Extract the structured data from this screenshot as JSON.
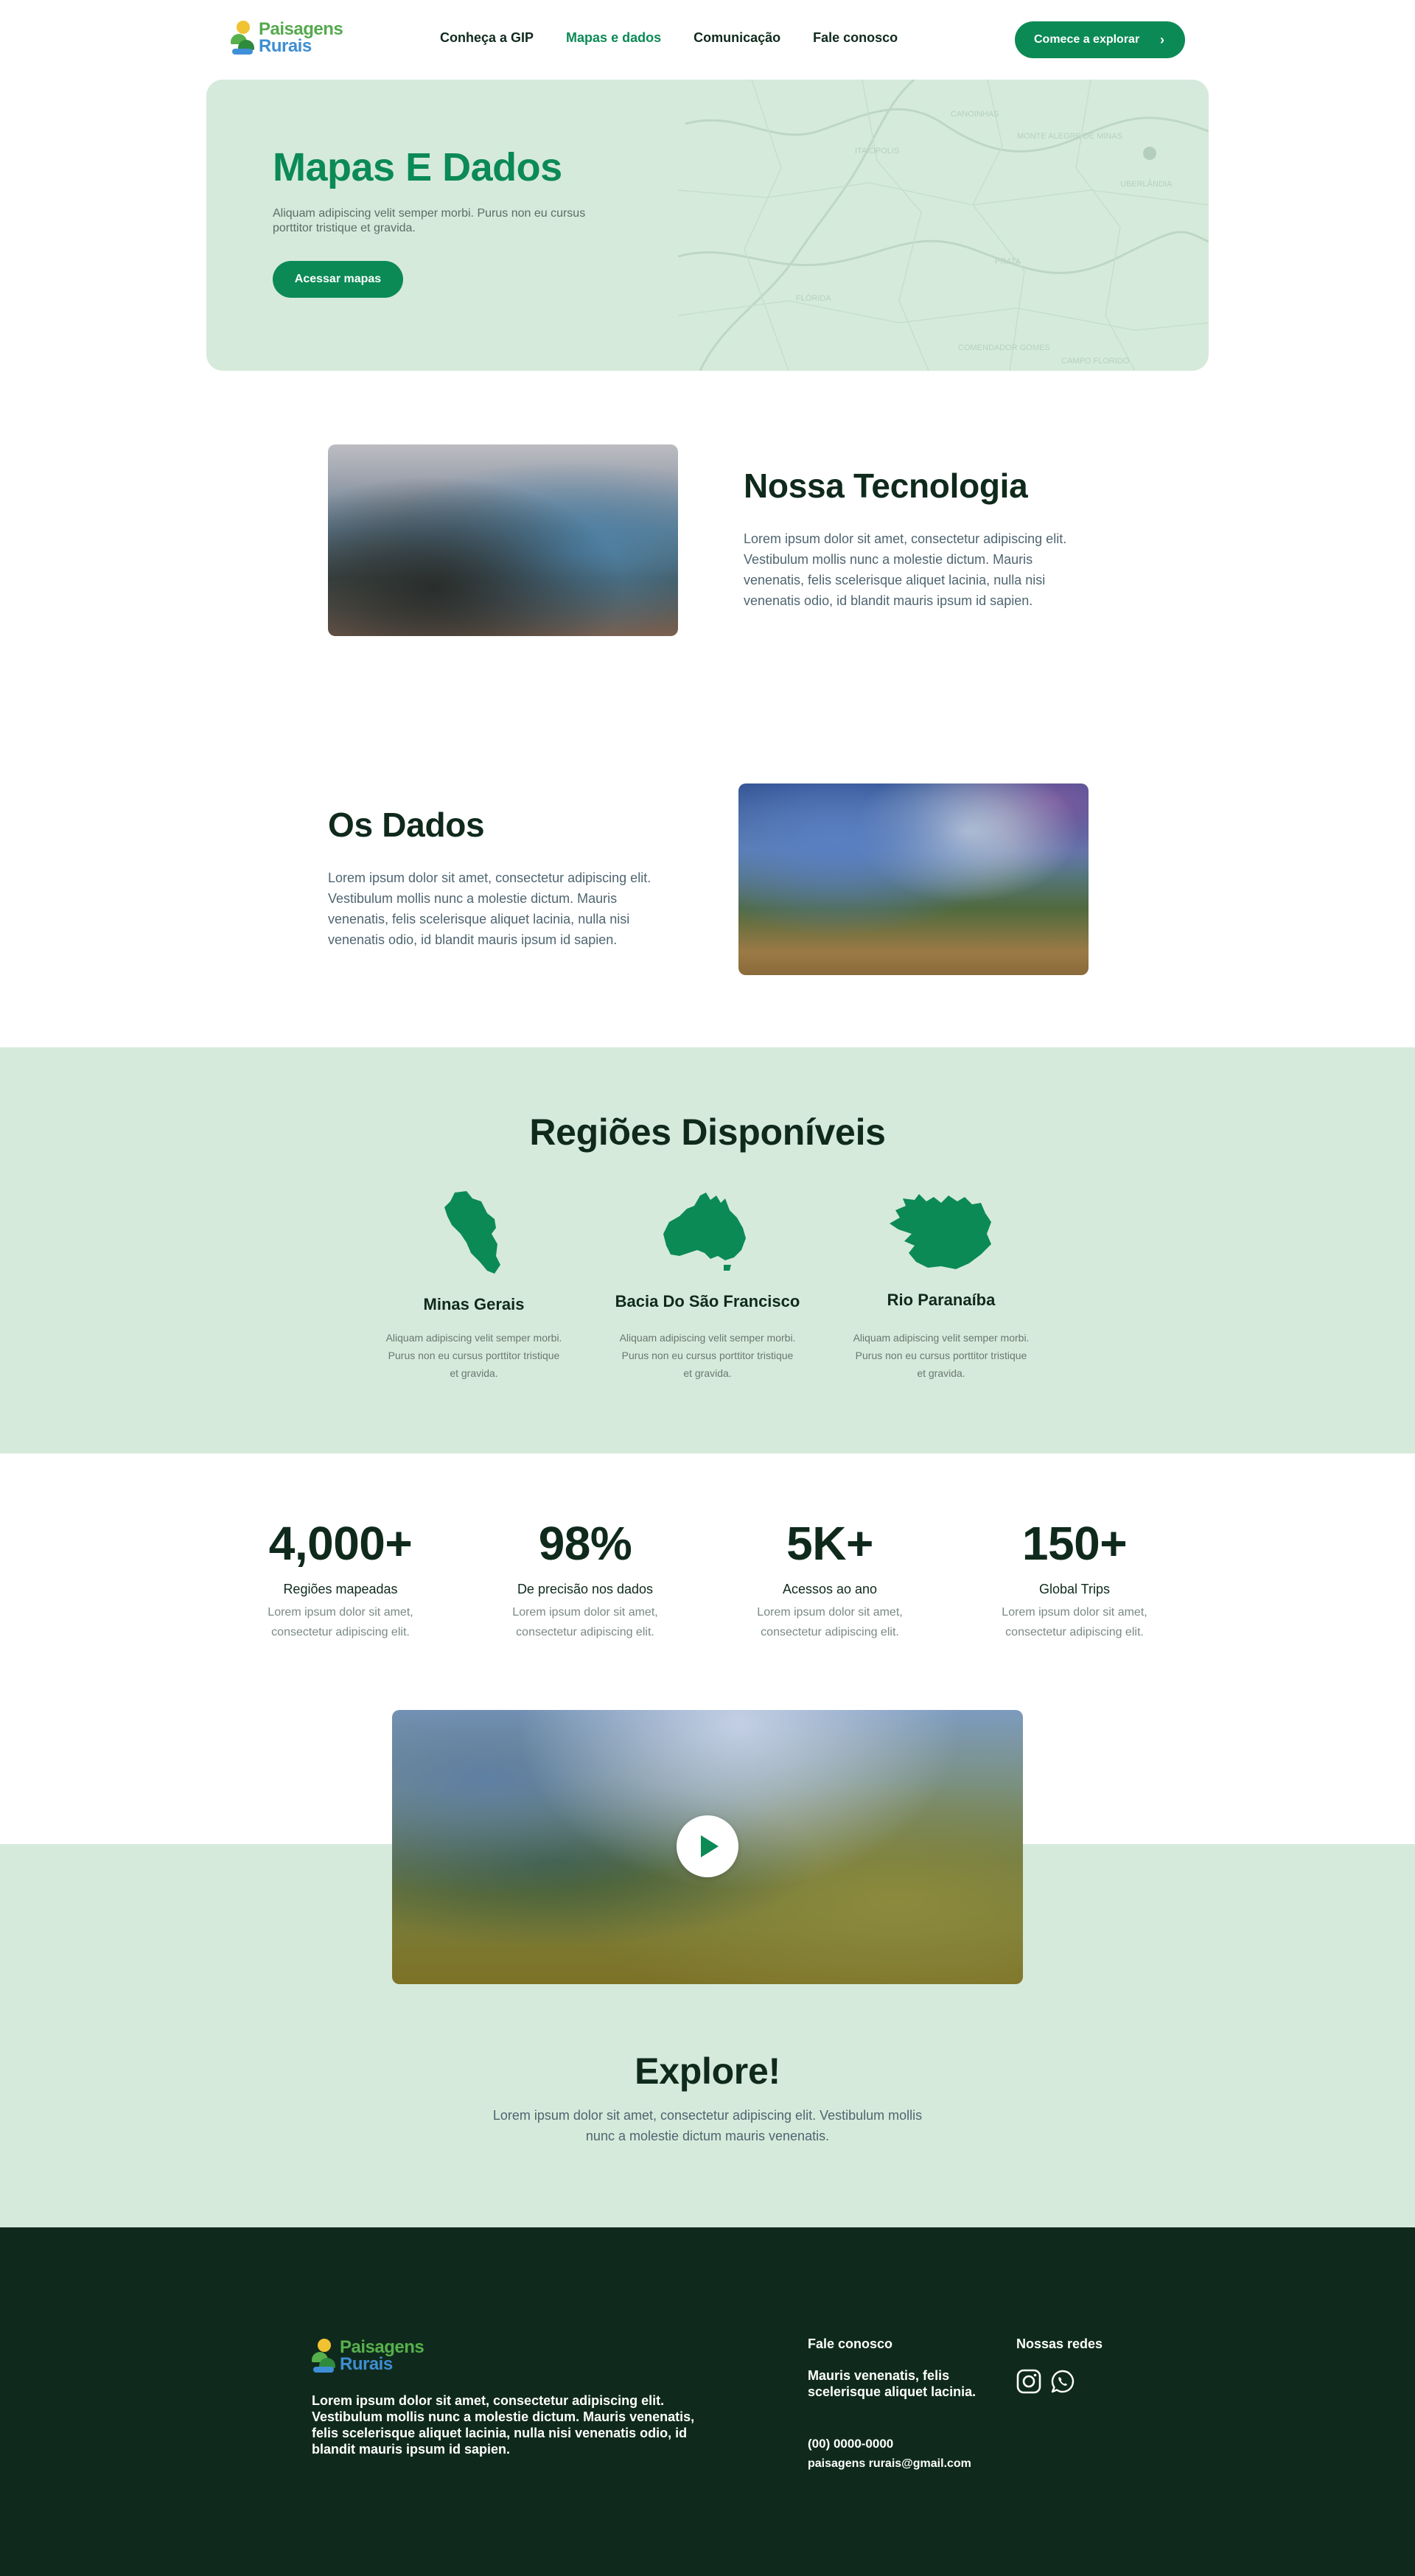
{
  "header": {
    "logo": {
      "line1": "Paisagens",
      "line2": "Rurais"
    },
    "nav": [
      "Conheça a GIP",
      "Mapas e dados",
      "Comunicação",
      "Fale conosco"
    ],
    "active_nav": "Mapas e dados",
    "cta_label": "Comece a explorar"
  },
  "hero": {
    "title": "Mapas E Dados",
    "text": "Aliquam adipiscing velit semper morbi. Purus non eu cursus porttitor tristique et gravida.",
    "button": "Acessar mapas",
    "map_labels": [
      "CANOINHAS",
      "ITAIÓPOLIS",
      "MONTE ALEGRE DE MINAS",
      "FLÓRIDA",
      "UBERLÂNDIA",
      "PRATA",
      "COMENDADOR GOMES",
      "CAMPO FLORIDO"
    ]
  },
  "technology": {
    "title": "Nossa Tecnologia",
    "text": "Lorem ipsum dolor sit amet, consectetur adipiscing elit. Vestibulum mollis nunc a molestie dictum. Mauris venenatis, felis scelerisque aliquet lacinia, nulla nisi venenatis odio, id blandit mauris ipsum id sapien."
  },
  "data_section": {
    "title": "Os Dados",
    "text": "Lorem ipsum dolor sit amet, consectetur adipiscing elit. Vestibulum mollis nunc a molestie dictum. Mauris venenatis, felis scelerisque aliquet lacinia, nulla nisi venenatis odio, id blandit mauris ipsum id sapien."
  },
  "regions": {
    "title": "Regiões Disponíveis",
    "items": [
      {
        "name": "Minas Gerais",
        "text": "Aliquam adipiscing velit semper morbi. Purus non eu cursus porttitor tristique et gravida."
      },
      {
        "name": "Bacia Do São Francisco",
        "text": "Aliquam adipiscing velit semper morbi. Purus non eu cursus porttitor tristique et gravida."
      },
      {
        "name": "Rio Paranaíba",
        "text": "Aliquam adipiscing velit semper morbi. Purus non eu cursus porttitor tristique et gravida."
      }
    ]
  },
  "stats": [
    {
      "value": "4,000+",
      "label": "Regiões mapeadas",
      "text": "Lorem ipsum dolor sit amet, consectetur adipiscing elit."
    },
    {
      "value": "98%",
      "label": "De precisão nos dados",
      "text": "Lorem ipsum dolor sit amet, consectetur adipiscing elit."
    },
    {
      "value": "5K+",
      "label": "Acessos ao ano",
      "text": "Lorem ipsum dolor sit amet, consectetur adipiscing elit."
    },
    {
      "value": "150+",
      "label": "Global Trips",
      "text": "Lorem ipsum dolor sit amet, consectetur adipiscing elit."
    }
  ],
  "explore": {
    "title": "Explore!",
    "text": "Lorem ipsum dolor sit amet, consectetur adipiscing elit. Vestibulum mollis nunc a molestie dictum mauris venenatis."
  },
  "footer": {
    "logo": {
      "line1": "Paisagens",
      "line2": "Rurais"
    },
    "about": "Lorem ipsum dolor sit amet, consectetur adipiscing elit. Vestibulum mollis nunc a molestie dictum. Mauris venenatis, felis scelerisque aliquet lacinia, nulla nisi venenatis odio, id blandit mauris ipsum id sapien.",
    "contact_title": "Fale conosco",
    "contact_address": "Mauris venenatis, felis scelerisque aliquet lacinia.",
    "phone": "(00) 0000-0000",
    "email": "paisagens rurais@gmail.com",
    "social_title": "Nossas redes",
    "social_icons": [
      "instagram-icon",
      "whatsapp-icon"
    ]
  },
  "colors": {
    "brand_green": "#0b8a55",
    "light_green_bg": "#d6eadb",
    "dark_green": "#0f2a1c",
    "text_gray": "#4f6570"
  }
}
